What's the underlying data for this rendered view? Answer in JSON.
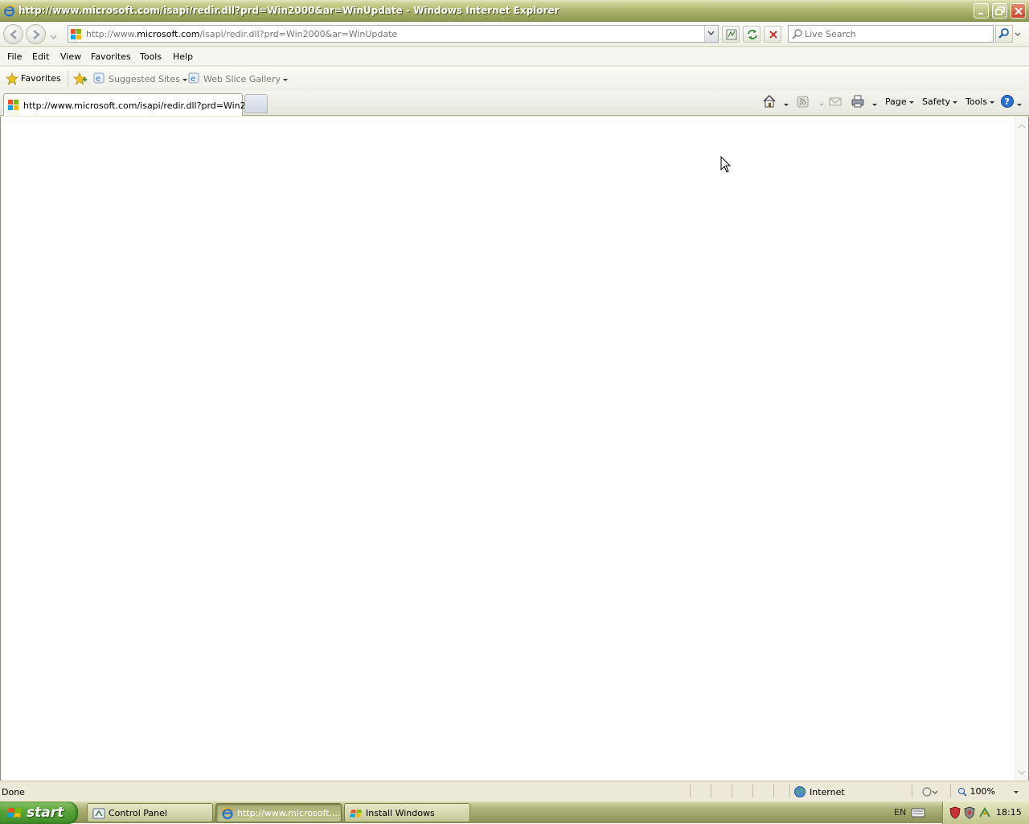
{
  "window": {
    "title": "http://www.microsoft.com/isapi/redir.dll?prd=Win2000&ar=WinUpdate - Windows Internet Explorer"
  },
  "address": {
    "url_prefix": "http://www.",
    "url_domain": "microsoft.com",
    "url_path": "/isapi/redir.dll?prd=Win2000&ar=WinUpdate"
  },
  "search": {
    "placeholder": "Live Search"
  },
  "menubar": {
    "items": [
      "File",
      "Edit",
      "View",
      "Favorites",
      "Tools",
      "Help"
    ]
  },
  "favorites_bar": {
    "favorites_label": "Favorites",
    "links": [
      "Suggested Sites",
      "Web Slice Gallery"
    ]
  },
  "tab": {
    "title": "http://www.microsoft.com/isapi/redir.dll?prd=Win200..."
  },
  "command_bar": {
    "page_label": "Page",
    "safety_label": "Safety",
    "tools_label": "Tools"
  },
  "status": {
    "text": "Done",
    "zone": "Internet",
    "zoom": "100%"
  },
  "taskbar": {
    "start_label": "start",
    "tasks": [
      "Control Panel",
      "http://www.microsoft....",
      "Install Windows"
    ],
    "language": "EN",
    "clock": "18:15"
  },
  "colors": {
    "titlebar": "#aab26a",
    "taskbar": "#9aa064",
    "start_button": "#5aa53a"
  }
}
